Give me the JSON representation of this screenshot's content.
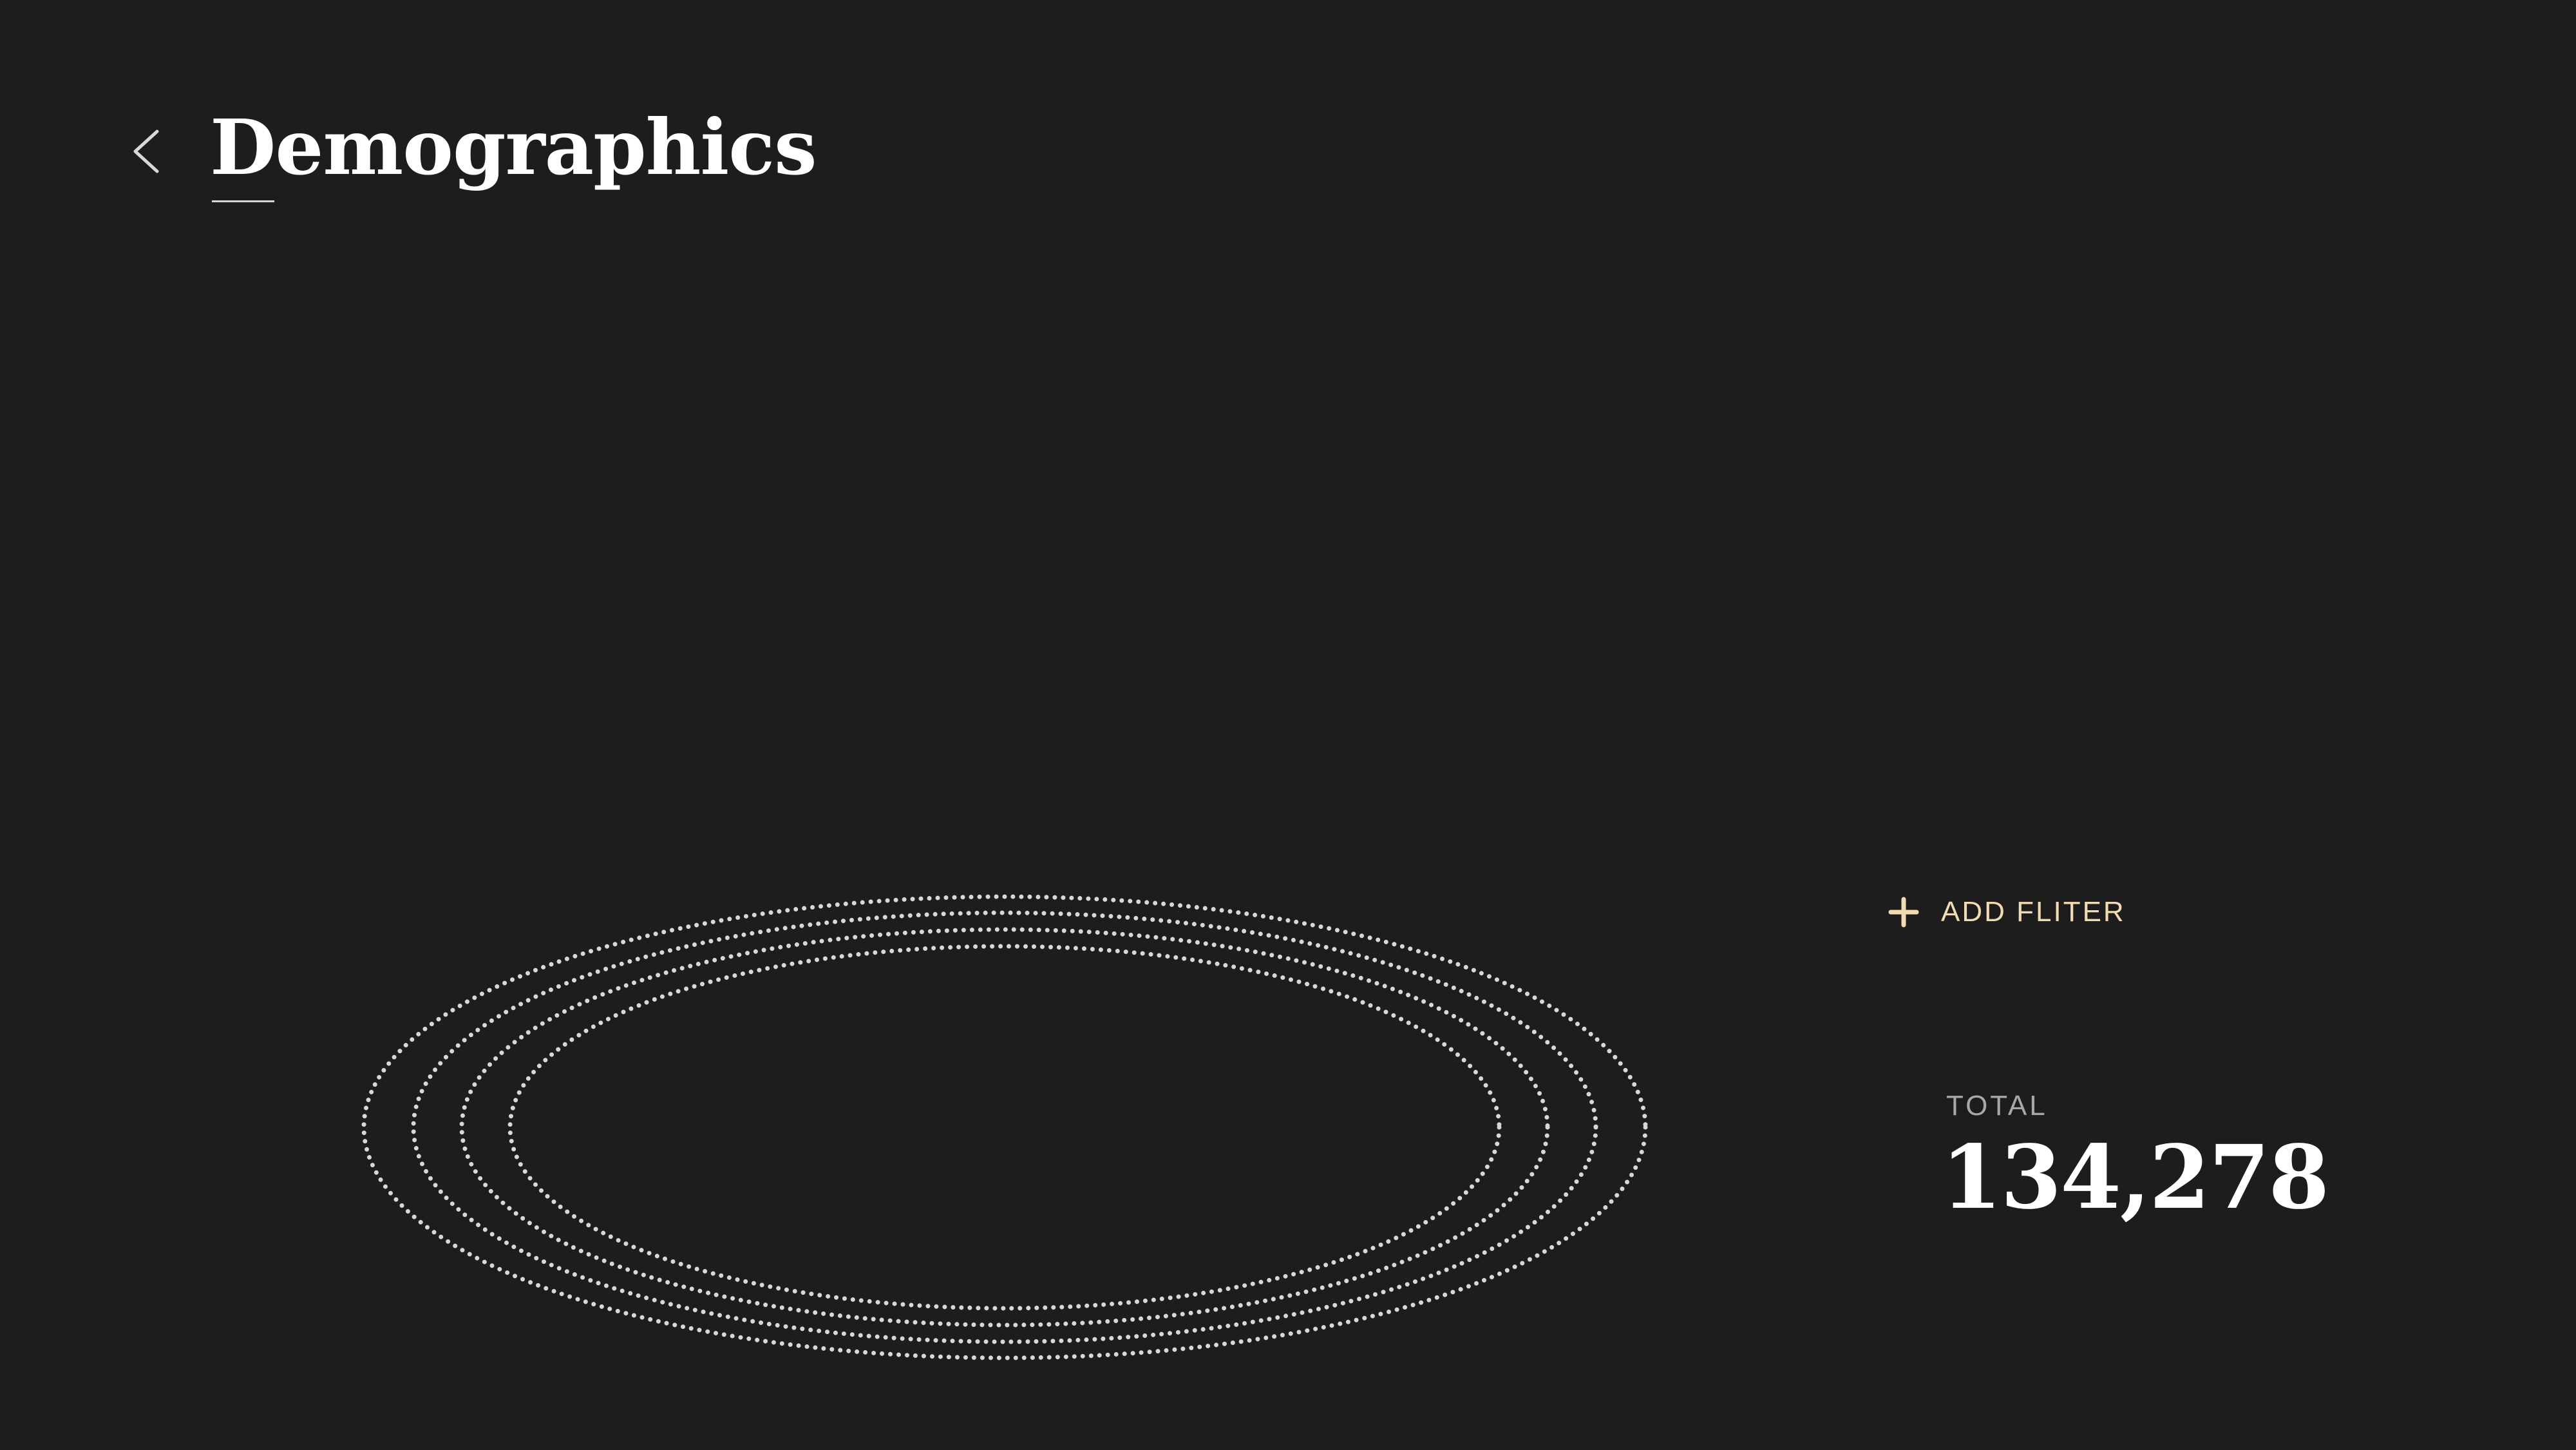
{
  "header": {
    "back_icon": "chevron-left-icon",
    "title": "Demographics"
  },
  "filter": {
    "icon": "plus-icon",
    "label": "ADD FLITER"
  },
  "total": {
    "label": "TOTAL",
    "value": "134,278"
  },
  "colors": {
    "background": "#1d1d1d",
    "accent": "#f3dbb1",
    "rings": "#d8d8d8",
    "text": "#ffffff",
    "muted": "#a8a8a8"
  }
}
